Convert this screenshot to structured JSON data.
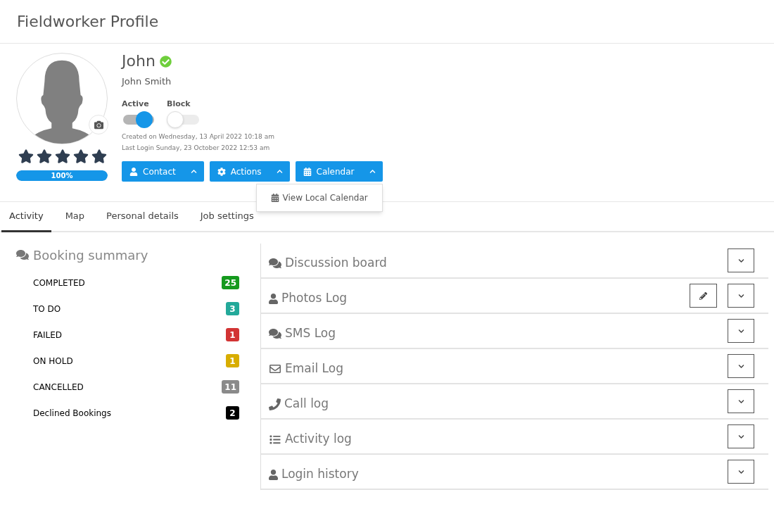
{
  "page_title": "Fieldworker Profile",
  "profile": {
    "name": "John",
    "verified": true,
    "full_name": "John Smith",
    "stars": 5,
    "completion": {
      "level": 1,
      "label": "100%"
    },
    "toggles": [
      {
        "label": "Active",
        "on": true
      },
      {
        "label": "Block",
        "on": false
      }
    ],
    "created": "Created on Wednesday, 13 April 2022 10:18 am",
    "last_login": "Last Login Sunday, 23 October 2022 12:53 am",
    "buttons": [
      {
        "kind": "user",
        "label": "Contact"
      },
      {
        "kind": "gear",
        "label": "Actions"
      },
      {
        "kind": "calendar",
        "label": "Calendar",
        "menu": [
          "View Local Calendar"
        ]
      }
    ]
  },
  "tabs": [
    {
      "label": "Activity",
      "selected": true
    },
    {
      "label": "Map",
      "selected": false
    },
    {
      "label": "Personal details",
      "selected": false
    },
    {
      "label": "Job settings",
      "selected": false
    }
  ],
  "booking_summary": {
    "title": "Booking summary",
    "items": [
      {
        "label": "COMPLETED",
        "count": "25",
        "color": "#159a1e"
      },
      {
        "label": "TO DO",
        "count": "3",
        "color": "#23a99a"
      },
      {
        "label": "FAILED",
        "count": "1",
        "color": "#d23434"
      },
      {
        "label": "ON HOLD",
        "count": "1",
        "color": "#d8ad00"
      },
      {
        "label": "CANCELLED",
        "count": "11",
        "color": "#8a8a8a"
      },
      {
        "label": "Declined Bookings",
        "count": "2",
        "color": "#000000"
      }
    ]
  },
  "panels": [
    {
      "kind": "chat",
      "title": "Discussion board",
      "editable": false
    },
    {
      "kind": "user",
      "title": "Photos Log",
      "editable": true
    },
    {
      "kind": "chat",
      "title": "SMS Log",
      "editable": false
    },
    {
      "kind": "mail",
      "title": "Email Log",
      "editable": false
    },
    {
      "kind": "phone",
      "title": "Call log",
      "editable": false
    },
    {
      "kind": "list",
      "title": "Activity log",
      "editable": false
    },
    {
      "kind": "user",
      "title": "Login history",
      "editable": false
    }
  ]
}
